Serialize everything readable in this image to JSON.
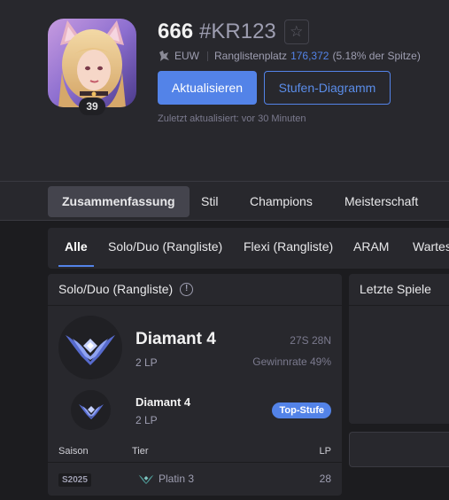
{
  "profile": {
    "level": "39",
    "game_name": "666",
    "tag_line": "#KR123",
    "region": "EUW",
    "ladder_label": "Ranglistenplatz",
    "ladder_rank": "176,372",
    "ladder_percent": "(5.18% der Spitze)",
    "refresh_label": "Aktualisieren",
    "tier_graph_label": "Stufen-Diagramm",
    "last_updated": "Zuletzt aktualisiert: vor 30 Minuten"
  },
  "main_tabs": [
    "Zusammenfassung",
    "Stil",
    "Champions",
    "Meisterschaft"
  ],
  "queue_tabs": [
    "Alle",
    "Solo/Duo (Rangliste)",
    "Flexi (Rangliste)",
    "ARAM",
    "Wartes"
  ],
  "ranked": {
    "title": "Solo/Duo (Rangliste)",
    "info_glyph": "!",
    "tier": "Diamant 4",
    "lp": "2 LP",
    "wins_losses": "27S 28N",
    "winrate": "Gewinnrate 49%",
    "peak_tier": "Diamant 4",
    "peak_lp": "2 LP",
    "peak_badge": "Top-Stufe",
    "season_headers": {
      "season": "Saison",
      "tier": "Tier",
      "lp": "LP"
    },
    "season_rows": [
      {
        "season": "S2025",
        "tier": "Platin 3",
        "lp": "28"
      }
    ]
  },
  "recent": {
    "title": "Letzte Spiele"
  },
  "icons": {
    "star": "☆",
    "region_icon": "map-pin-icon",
    "diamond_emblem": "diamond-emblem-icon",
    "platinum_emblem": "platinum-emblem-icon"
  },
  "colors": {
    "accent": "#5383e8",
    "background": "#1c1c1f",
    "panel": "#28282d",
    "diamond": "#576bce",
    "platinum": "#4e9996"
  }
}
